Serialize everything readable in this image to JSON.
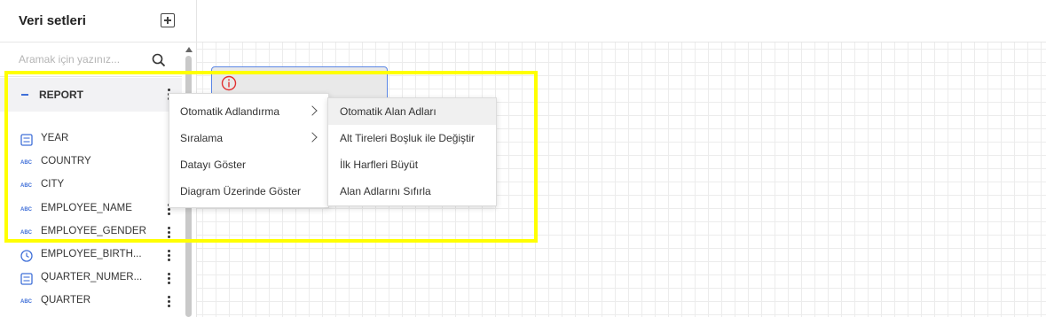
{
  "sidebar": {
    "title": "Veri setleri",
    "search_placeholder": "Aramak için yazınız...",
    "group": {
      "label": "REPORT"
    },
    "fields": [
      {
        "label": "YEAR",
        "icon": "number-icon"
      },
      {
        "label": "COUNTRY",
        "icon": "abc-icon"
      },
      {
        "label": "CITY",
        "icon": "abc-icon"
      },
      {
        "label": "EMPLOYEE_NAME",
        "icon": "abc-icon"
      },
      {
        "label": "EMPLOYEE_GENDER",
        "icon": "abc-icon"
      },
      {
        "label": "EMPLOYEE_BIRTH...",
        "icon": "clock-icon"
      },
      {
        "label": "QUARTER_NUMER...",
        "icon": "number-icon"
      },
      {
        "label": "QUARTER",
        "icon": "abc-icon"
      }
    ],
    "abc_text": "ABC"
  },
  "context_menu": {
    "items": [
      {
        "label": "Otomatik Adlandırma",
        "has_submenu": true
      },
      {
        "label": "Sıralama",
        "has_submenu": true
      },
      {
        "label": "Datayı Göster",
        "has_submenu": false
      },
      {
        "label": "Diagram Üzerinde Göster",
        "has_submenu": false
      }
    ]
  },
  "submenu": {
    "items": [
      {
        "label": "Otomatik Alan Adları"
      },
      {
        "label": "Alt Tireleri Boşluk ile Değiştir"
      },
      {
        "label": "İlk Harfleri Büyüt"
      },
      {
        "label": "Alan Adlarını Sıfırla"
      }
    ]
  },
  "colors": {
    "accent": "#3f6fd8",
    "highlight": "#ffff00",
    "warning": "#e03131"
  }
}
